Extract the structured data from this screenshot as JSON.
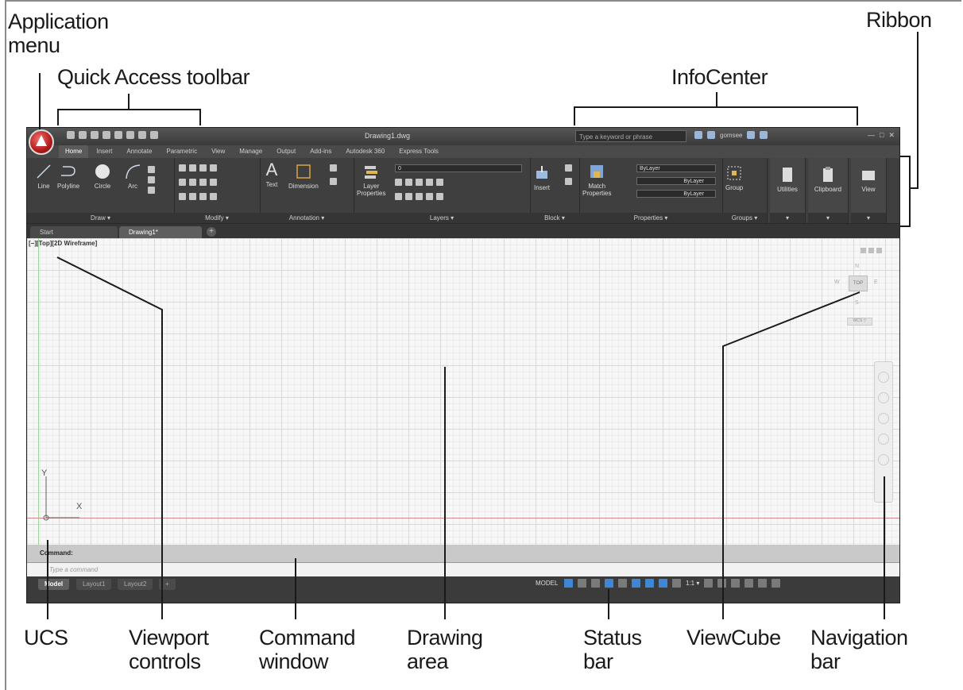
{
  "callouts": {
    "application_menu": "Application\nmenu",
    "quick_access_toolbar": "Quick Access toolbar",
    "infocenter": "InfoCenter",
    "ribbon": "Ribbon",
    "ucs": "UCS",
    "viewport_controls": "Viewport\ncontrols",
    "command_window": "Command\nwindow",
    "drawing_area": "Drawing\narea",
    "status_bar": "Status\nbar",
    "viewcube": "ViewCube",
    "navigation_bar": "Navigation\nbar"
  },
  "app": {
    "window_title": "Drawing1.dwg",
    "search_placeholder": "Type a keyword or phrase",
    "user_name": "gomsee",
    "ribbon_tabs": [
      "Home",
      "Insert",
      "Annotate",
      "Parametric",
      "View",
      "Manage",
      "Output",
      "Add-ins",
      "Autodesk 360",
      "Express Tools"
    ],
    "draw_tools": [
      "Line",
      "Polyline",
      "Circle",
      "Arc"
    ],
    "groups": {
      "draw": "Draw ▾",
      "modify": "Modify ▾",
      "annotation": "Annotation ▾",
      "layers": "Layers ▾",
      "block": "Block ▾",
      "properties": "Properties ▾",
      "groups": "Groups ▾"
    },
    "annotation_tools": [
      "Text",
      "Dimension"
    ],
    "layer_properties": "Layer\nProperties",
    "insert_tool": "Insert",
    "match_properties": "Match\nProperties",
    "group_tool": "Group",
    "bylayer": "ByLayer",
    "utilities": "Utilities",
    "clipboard": "Clipboard",
    "view": "View",
    "doc_tabs": [
      "Start",
      "Drawing1*"
    ],
    "viewport_label": "[−][Top][2D Wireframe]",
    "viewcube_labels": {
      "n": "N",
      "s": "S",
      "e": "E",
      "w": "W",
      "top": "TOP",
      "wcs": "WCS ▽"
    },
    "ucs_labels": {
      "y": "Y",
      "x": "X"
    },
    "command_history": "Command:",
    "command_placeholder": "Type a command",
    "layout_tabs": [
      "Model",
      "Layout1",
      "Layout2"
    ],
    "status_model": "MODEL",
    "status_scale": "1:1 ▾"
  }
}
